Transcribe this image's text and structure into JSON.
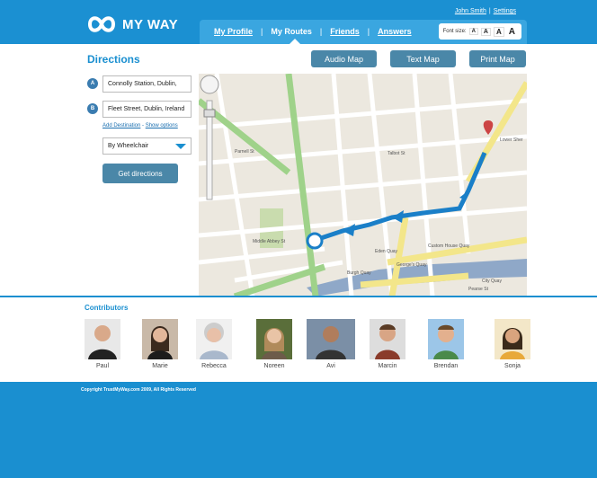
{
  "header": {
    "brand": "MY WAY",
    "user_link": "John Smith",
    "settings_link": "Settings",
    "nav": [
      {
        "label": "My Profile"
      },
      {
        "label": "My Routes"
      },
      {
        "label": "Friends"
      },
      {
        "label": "Answers"
      }
    ],
    "font_size_label": "Font size:",
    "font_size_options": [
      "A",
      "A",
      "A",
      "A"
    ]
  },
  "directions": {
    "title": "Directions",
    "audio_map": "Audio Map",
    "text_map": "Text Map",
    "print_map": "Print Map",
    "marker_a": "A",
    "marker_b": "B",
    "from_value": "Connolly Station, Dublin,",
    "to_value": "Fleet Street, Dublin, Ireland",
    "add_destination": "Add Destination",
    "link_sep": "-",
    "show_options": "Show options",
    "mode": "By Wheelchair",
    "get_directions": "Get directions"
  },
  "map": {
    "labels": [
      "Custom House Quay",
      "Eden Quay",
      "George's Quay",
      "Burgh Quay",
      "Talbot St",
      "Lower Sher",
      "Parnell St",
      "Middle Abbey St",
      "City Quay",
      "Pearse St"
    ],
    "route_color": "#1a7fc8"
  },
  "contributors": {
    "title": "Contributors",
    "people": [
      {
        "name": "Paul"
      },
      {
        "name": "Marie"
      },
      {
        "name": "Rebecca"
      },
      {
        "name": "Noreen"
      },
      {
        "name": "Avi"
      },
      {
        "name": "Marcin"
      },
      {
        "name": "Brendan"
      },
      {
        "name": "Sonja"
      }
    ]
  },
  "footer": {
    "copyright": "Copyright TrustMyWay.com 2009, All Rights Reserved"
  }
}
